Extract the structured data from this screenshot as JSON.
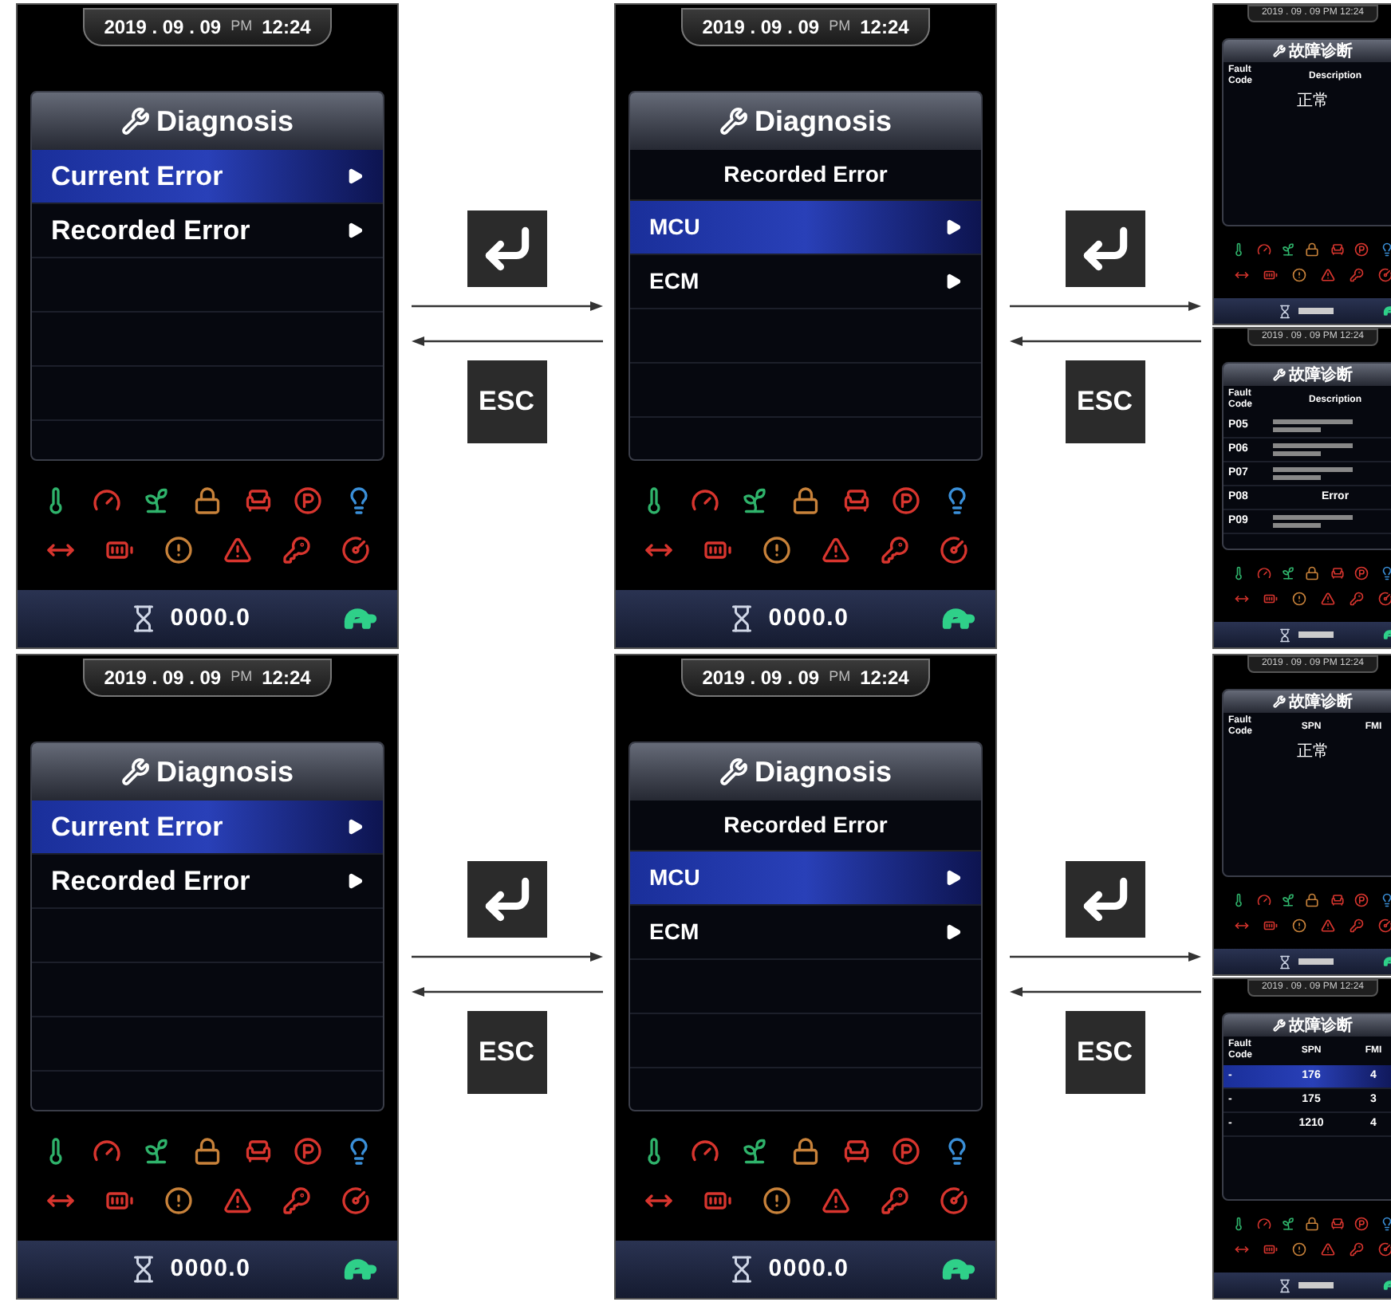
{
  "flows": [
    {
      "menu_screen": {
        "date": "2019 . 09 . 09",
        "meridiem": "PM",
        "time": "12:24",
        "title": "Diagnosis",
        "items": [
          {
            "label": "Current Error",
            "selected": true
          },
          {
            "label": "Recorded Error",
            "selected": false
          }
        ],
        "odometer": "0000.0"
      },
      "connector_1": {
        "keys": [
          {
            "kind": "enter"
          },
          {
            "kind": "esc",
            "label": "ESC"
          }
        ]
      },
      "recorded_screen": {
        "date": "2019 . 09 . 09",
        "meridiem": "PM",
        "time": "12:24",
        "title": "Diagnosis",
        "subtitle": "Recorded Error",
        "items": [
          {
            "label": "MCU",
            "selected": true
          },
          {
            "label": "ECM",
            "selected": false
          }
        ],
        "odometer": "0000.0"
      },
      "connector_2": {
        "keys": [
          {
            "kind": "enter"
          },
          {
            "kind": "esc",
            "label": "ESC"
          }
        ]
      },
      "result_screens": [
        {
          "datetime": "2019 . 09 . 09 PM 12:24",
          "title": "故障诊断",
          "columns": [
            "Fault Code",
            "Description"
          ],
          "message": "正常"
        },
        {
          "datetime": "2019 . 09 . 09 PM 12:24",
          "title": "故障诊断",
          "columns": [
            "Fault Code",
            "Description"
          ],
          "rows": [
            {
              "cells": [
                "P05"
              ],
              "selected": false
            },
            {
              "cells": [
                "P06"
              ],
              "selected": false
            },
            {
              "cells": [
                "P07"
              ],
              "selected": false
            },
            {
              "cells": [
                "P08",
                "Error"
              ],
              "selected": false
            },
            {
              "cells": [
                "P09"
              ],
              "selected": false
            }
          ]
        }
      ]
    },
    {
      "menu_screen": {
        "date": "2019 . 09 . 09",
        "meridiem": "PM",
        "time": "12:24",
        "title": "Diagnosis",
        "items": [
          {
            "label": "Current Error",
            "selected": true
          },
          {
            "label": "Recorded Error",
            "selected": false
          }
        ],
        "odometer": "0000.0"
      },
      "connector_1": {
        "keys": [
          {
            "kind": "enter"
          },
          {
            "kind": "esc",
            "label": "ESC"
          }
        ]
      },
      "recorded_screen": {
        "date": "2019 . 09 . 09",
        "meridiem": "PM",
        "time": "12:24",
        "title": "Diagnosis",
        "subtitle": "Recorded Error",
        "items": [
          {
            "label": "MCU",
            "selected": true
          },
          {
            "label": "ECM",
            "selected": false
          }
        ],
        "odometer": "0000.0"
      },
      "connector_2": {
        "keys": [
          {
            "kind": "enter"
          },
          {
            "kind": "esc",
            "label": "ESC"
          }
        ]
      },
      "result_screens": [
        {
          "datetime": "2019 . 09 . 09 PM 12:24",
          "title": "故障诊断",
          "columns": [
            "Fault Code",
            "SPN",
            "FMI"
          ],
          "message": "正常"
        },
        {
          "datetime": "2019 . 09 . 09 PM 12:24",
          "title": "故障诊断",
          "columns": [
            "Fault Code",
            "SPN",
            "FMI"
          ],
          "rows": [
            {
              "cells": [
                "-",
                "176",
                "4"
              ],
              "selected": true
            },
            {
              "cells": [
                "-",
                "175",
                "3"
              ],
              "selected": false
            },
            {
              "cells": [
                "-",
                "1210",
                "4"
              ],
              "selected": false
            }
          ]
        }
      ]
    }
  ]
}
